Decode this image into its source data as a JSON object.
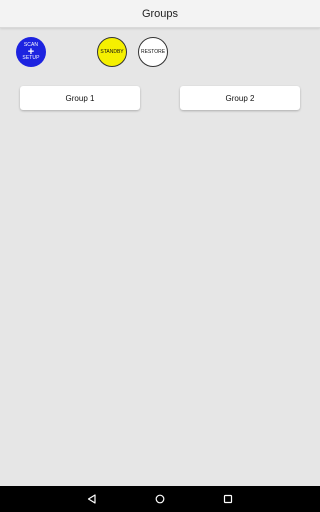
{
  "header": {
    "title": "Groups"
  },
  "actions": {
    "scan": {
      "line1": "SCAN",
      "plus": "+",
      "line2": "SETUP"
    },
    "standby": {
      "label": "STANDBY"
    },
    "restore": {
      "label": "RESTORE"
    }
  },
  "groups": [
    {
      "label": "Group 1"
    },
    {
      "label": "Group 2"
    }
  ],
  "navbar": {
    "icons": [
      "back-icon",
      "home-icon",
      "recents-icon"
    ]
  },
  "colors": {
    "background": "#e6e6e6",
    "scan_button": "#1d23e0",
    "standby_button": "#f5f000",
    "restore_button": "#ffffff",
    "navbar": "#000000"
  }
}
